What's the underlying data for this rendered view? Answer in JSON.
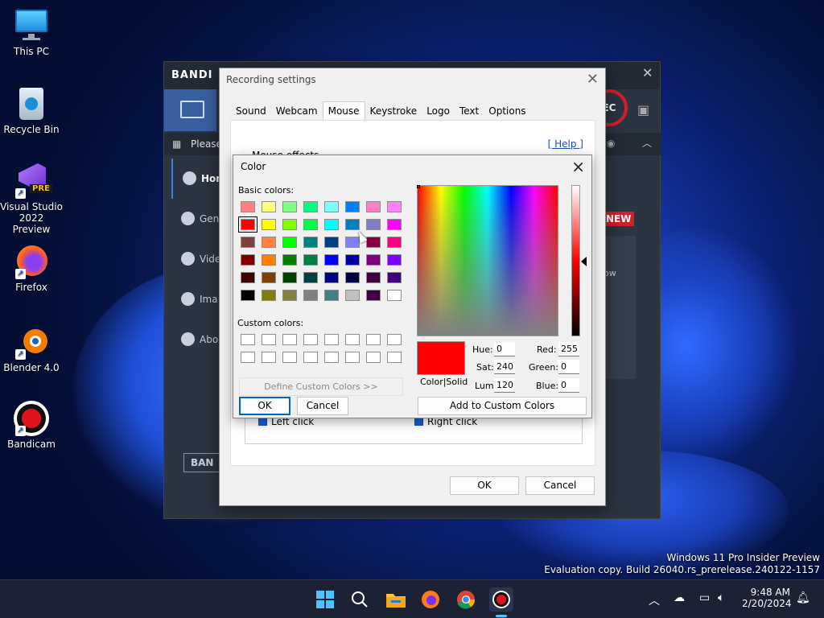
{
  "desktop": {
    "icons": [
      {
        "label": "This PC"
      },
      {
        "label": "Recycle Bin"
      },
      {
        "label": "Visual Studio 2022 Preview",
        "badge": "PRE"
      },
      {
        "label": "Firefox"
      },
      {
        "label": "Blender 4.0"
      },
      {
        "label": "Bandicam"
      }
    ],
    "watermark_line1": "Windows 11 Pro Insider Preview",
    "watermark_line2": "Evaluation copy. Build 26040.rs_prerelease.240122-1157"
  },
  "bandicam": {
    "logo": "BANDI",
    "notice": "Please",
    "rec_label": "EC",
    "side_items": [
      "Hon",
      "Gen",
      "Vide",
      "Ima",
      "Abo"
    ],
    "new_badge": "NEW",
    "right_text": "ow",
    "footer_logo": "BAN"
  },
  "recording_settings": {
    "title": "Recording settings",
    "tabs": [
      "Sound",
      "Webcam",
      "Mouse",
      "Keystroke",
      "Logo",
      "Text",
      "Options"
    ],
    "active_tab": "Mouse",
    "help": "[ Help ]",
    "effects_label": "Mouse effects",
    "left_click": "Left click",
    "right_click": "Right click",
    "ok": "OK",
    "cancel": "Cancel"
  },
  "color_dialog": {
    "title": "Color",
    "basic_colors_label": "Basic colors:",
    "basic_colors": [
      [
        "#ff8080",
        "#ffff80",
        "#80ff80",
        "#00ff80",
        "#80ffff",
        "#0080ff",
        "#ff80c0",
        "#ff80ff"
      ],
      [
        "#ff0000",
        "#ffff00",
        "#80ff00",
        "#00ff40",
        "#00ffff",
        "#0080c0",
        "#8080c0",
        "#ff00ff"
      ],
      [
        "#804040",
        "#ff8040",
        "#00ff00",
        "#008080",
        "#004080",
        "#8080ff",
        "#800040",
        "#ff0080"
      ],
      [
        "#800000",
        "#ff8000",
        "#008000",
        "#008040",
        "#0000ff",
        "#0000a0",
        "#800080",
        "#8000ff"
      ],
      [
        "#400000",
        "#804000",
        "#004000",
        "#004040",
        "#000080",
        "#000040",
        "#400040",
        "#400080"
      ],
      [
        "#000000",
        "#808000",
        "#808040",
        "#808080",
        "#408080",
        "#c0c0c0",
        "#400040",
        "#ffffff"
      ]
    ],
    "selected_swatch": "#ff0000",
    "custom_colors_label": "Custom colors:",
    "define_custom": "Define Custom Colors >>",
    "ok": "OK",
    "cancel": "Cancel",
    "color_solid": "Color|Solid",
    "hue_label": "Hue:",
    "hue": "0",
    "sat_label": "Sat:",
    "sat": "240",
    "lum_label": "Lum:",
    "lum": "120",
    "red_label": "Red:",
    "red": "255",
    "green_label": "Green:",
    "green": "0",
    "blue_label": "Blue:",
    "blue": "0",
    "add_custom": "Add to Custom Colors"
  },
  "taskbar": {
    "time": "9:48 AM",
    "date": "2/20/2024"
  }
}
